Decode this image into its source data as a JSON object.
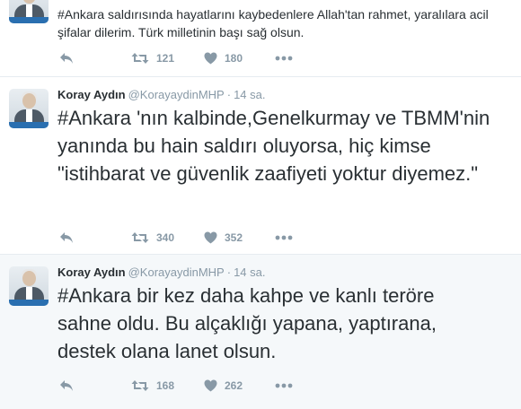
{
  "tweets": [
    {
      "author": "",
      "handle": "",
      "time": "",
      "hashtag": "#Ankara",
      "text": " saldırısında hayatlarını kaybedenlere Allah'tan rahmet, yaralılara acil şifalar dilerim. Türk milletinin başı sağ olsun.",
      "retweets": "121",
      "likes": "180"
    },
    {
      "author": "Koray Aydın",
      "handle": "@KorayaydinMHP",
      "time": "14 sa.",
      "hashtag": "#Ankara",
      "text": " 'nın kalbinde,Genelkurmay ve TBMM'nin yanında bu hain saldırı oluyorsa, hiç kimse \"istihbarat ve güvenlik zaafiyeti yoktur diyemez.\"",
      "retweets": "340",
      "likes": "352"
    },
    {
      "author": "Koray Aydın",
      "handle": "@KorayaydinMHP",
      "time": "14 sa.",
      "hashtag": "#Ankara",
      "text": " bir kez daha kahpe ve kanlı teröre sahne oldu. Bu alçaklığı yapana, yaptırana, destek olana lanet olsun.",
      "retweets": "168",
      "likes": "262"
    }
  ],
  "separator": "·",
  "icons": [
    "reply-icon",
    "retweet-icon",
    "like-icon",
    "more-icon"
  ],
  "colors": {
    "text": "#292f33",
    "muted": "#8899a6",
    "hover_bg": "#f5f8fa"
  }
}
